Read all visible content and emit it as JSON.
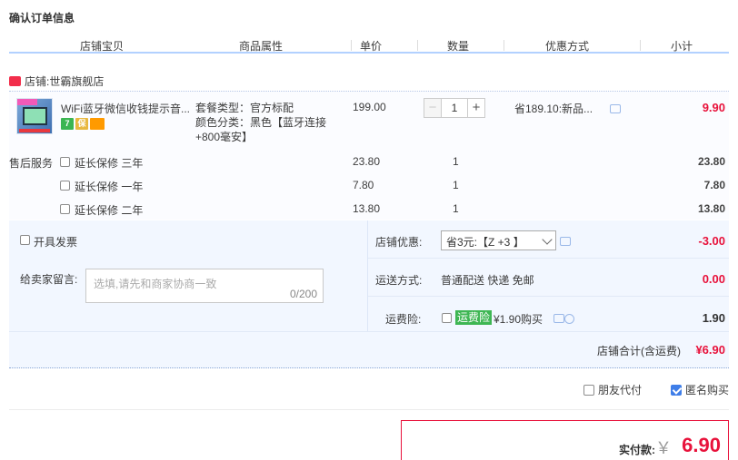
{
  "title": "确认订单信息",
  "columns": {
    "shop_item": "店铺宝贝",
    "attributes": "商品属性",
    "unit_price": "单价",
    "quantity": "数量",
    "discount": "优惠方式",
    "subtotal": "小计"
  },
  "shop": {
    "label": "店铺:",
    "name": "世霸旗舰店"
  },
  "item": {
    "title": "WiFi蓝牙微信收钱提示音...",
    "attr_line1": "套餐类型：官方标配",
    "attr_line2": "颜色分类：黑色【蓝牙连接+800毫安】",
    "price": "199.00",
    "quantity": "1",
    "discount": "省189.10:新品...",
    "subtotal": "9.90",
    "icon_seven": "7",
    "icon_guard": "保"
  },
  "service": {
    "label": "售后服务",
    "options": [
      {
        "name": "延长保修 三年",
        "price": "23.80",
        "qty": "1",
        "subtotal": "23.80"
      },
      {
        "name": "延长保修 一年",
        "price": "7.80",
        "qty": "1",
        "subtotal": "7.80"
      },
      {
        "name": "延长保修 二年",
        "price": "13.80",
        "qty": "1",
        "subtotal": "13.80"
      }
    ]
  },
  "invoice_label": "开具发票",
  "message": {
    "label": "给卖家留言:",
    "placeholder": "选填,请先和商家协商一致",
    "count": "0/200"
  },
  "shop_discount": {
    "label": "店铺优惠:",
    "selected": "省3元:【Z +3 】",
    "value": "-3.00"
  },
  "shipping": {
    "label": "运送方式:",
    "text": "普通配送 快递 免邮",
    "value": "0.00"
  },
  "insurance": {
    "label": "运费险:",
    "tag": "运费险",
    "price": "¥1.90购买",
    "value": "1.90"
  },
  "shop_total": {
    "label": "店铺合计(含运费)",
    "value": "¥6.90"
  },
  "friend_pay": "朋友代付",
  "anonymous": "匿名购买",
  "payment": {
    "label": "实付款:",
    "currency": "￥",
    "value": "6.90"
  }
}
